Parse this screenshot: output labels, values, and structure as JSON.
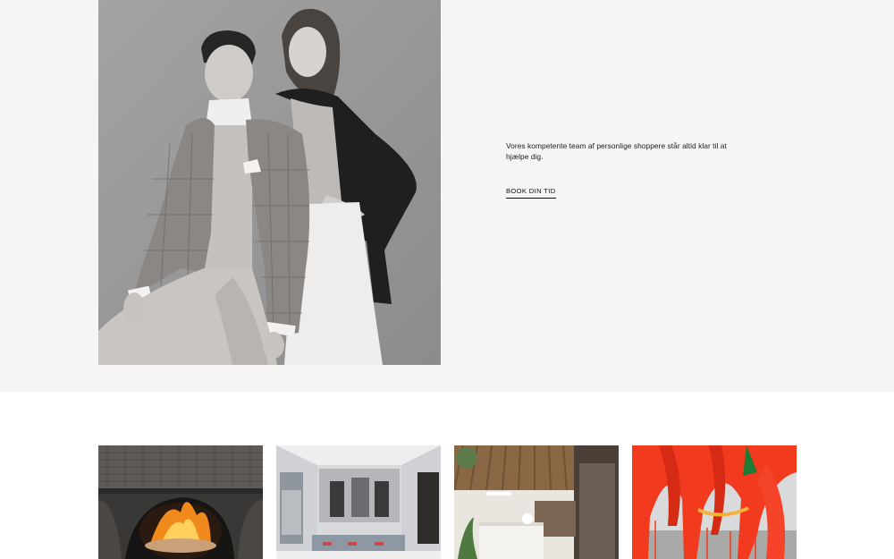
{
  "hero": {
    "portrait_alt": "Personal shoppers portrait",
    "description": "Vores kompetente team af personlige shoppere står altid klar til at hjælpe dig.",
    "cta_label": "BOOK DIN TID"
  },
  "tiles": [
    {
      "alt": "Wood-fired oven",
      "icon": "oven-image"
    },
    {
      "alt": "Jewelry store interior",
      "icon": "store-image"
    },
    {
      "alt": "Reception lobby",
      "icon": "lobby-image"
    },
    {
      "alt": "Red textile installation",
      "icon": "art-image"
    }
  ],
  "colors": {
    "hero_background": "#f6f5f4",
    "page_background": "#ffffff",
    "text": "#1c1c1c"
  }
}
